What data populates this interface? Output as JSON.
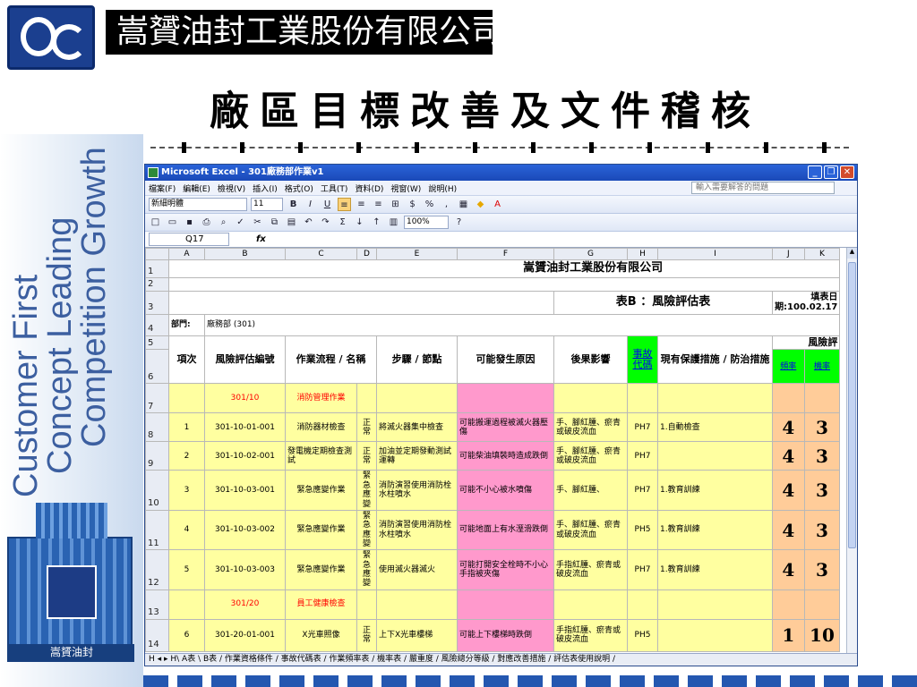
{
  "slide": {
    "company": "嵩贇油封工業股份有限公司",
    "title": "廠區目標改善及文件稽核",
    "side_texts": [
      "Customer First",
      "Concept Leading",
      "Competition Growth"
    ]
  },
  "excel": {
    "window_title": "Microsoft Excel - 301廠務部作業v1",
    "menu": [
      "檔案(F)",
      "編輯(E)",
      "檢視(V)",
      "插入(I)",
      "格式(O)",
      "工具(T)",
      "資料(D)",
      "視窗(W)",
      "說明(H)"
    ],
    "help_placeholder": "輸入需要解答的問題",
    "font_name": "新細明體",
    "font_size": "11",
    "zoom": "100%",
    "name_box": "Q17",
    "fx_label": "fx",
    "columns": [
      "A",
      "B",
      "C",
      "D",
      "E",
      "F",
      "G",
      "H",
      "I",
      "J",
      "K"
    ],
    "header": {
      "company": "嵩贇油封工業股份有限公司",
      "form": "表B ：風險評估表",
      "date": "填表日期:100.02.17",
      "dept_label": "部門:",
      "dept_value": "廠務部 (301)"
    },
    "col_titles": {
      "item": "項次",
      "code": "風險評估編號",
      "process": "作業流程 / 名稱",
      "step": "步驟 / 節點",
      "cause": "可能發生原因",
      "effect": "後果影響",
      "accident": "事故代碼",
      "measure": "現有保護措施 / 防治措施",
      "risk": "風險評",
      "freq": "頻率",
      "prob": "機率"
    },
    "rows": [
      {
        "row": "7",
        "group": true,
        "code": "301/10",
        "process": "消防管理作業"
      },
      {
        "row": "8",
        "item": "1",
        "code": "301-10-01-001",
        "process": "消防器材檢查",
        "d": "正常",
        "step": "將滅火器集中檢查",
        "cause": "可能搬運過程被滅火器壓傷",
        "effect": "手、腳紅腫、瘀青或破皮流血",
        "acc": "PH7",
        "measure": "1.自動檢查",
        "j": "4",
        "k": "3"
      },
      {
        "row": "9",
        "item": "2",
        "code": "301-10-02-001",
        "process": "發電機定期檢查測試",
        "d": "正常",
        "step": "加油並定期發動測試運轉",
        "cause": "可能柴油填裝時造成跌倒",
        "effect": "手、腳紅腫、瘀青或破皮流血",
        "acc": "PH7",
        "measure": "",
        "j": "4",
        "k": "3"
      },
      {
        "row": "10",
        "item": "3",
        "code": "301-10-03-001",
        "process": "緊急應變作業",
        "d": "緊急應變",
        "step": "消防演習使用消防栓水柱噴水",
        "cause": "可能不小心被水噴傷",
        "effect": "手、腳紅腫、",
        "acc": "PH7",
        "measure": "1.教育訓練",
        "j": "4",
        "k": "3"
      },
      {
        "row": "11",
        "item": "4",
        "code": "301-10-03-002",
        "process": "緊急應變作業",
        "d": "緊急應變",
        "step": "消防演習使用消防栓水柱噴水",
        "cause": "可能地面上有水溼滑跌倒",
        "effect": "手、腳紅腫、瘀青或破皮流血",
        "acc": "PH5",
        "measure": "1.教育訓練",
        "j": "4",
        "k": "3"
      },
      {
        "row": "12",
        "item": "5",
        "code": "301-10-03-003",
        "process": "緊急應變作業",
        "d": "緊急應變",
        "step": "使用滅火器滅火",
        "cause": "可能打開安全栓時不小心手指被夾傷",
        "effect": "手指紅腫、瘀青或破皮流血",
        "acc": "PH7",
        "measure": "1.教育訓練",
        "j": "4",
        "k": "3"
      },
      {
        "row": "13",
        "group": true,
        "code": "301/20",
        "process": "員工健康檢查"
      },
      {
        "row": "14",
        "item": "6",
        "code": "301-20-01-001",
        "process": "X光車照像",
        "d": "正常",
        "step": "上下X光車樓梯",
        "cause": "可能上下樓梯時跌倒",
        "effect": "手指紅腫、瘀青或破皮流血",
        "acc": "PH5",
        "measure": "",
        "j": "1",
        "k": "10"
      }
    ],
    "sheet_tabs": "H ◂ ▸ H\\ A表 \\ B表 / 作業資格條件 / 事故代碼表 / 作業頻率表 / 機率表 / 嚴重度 / 風險總分等級 / 對應改善措施 / 評估表使用說明 /"
  }
}
